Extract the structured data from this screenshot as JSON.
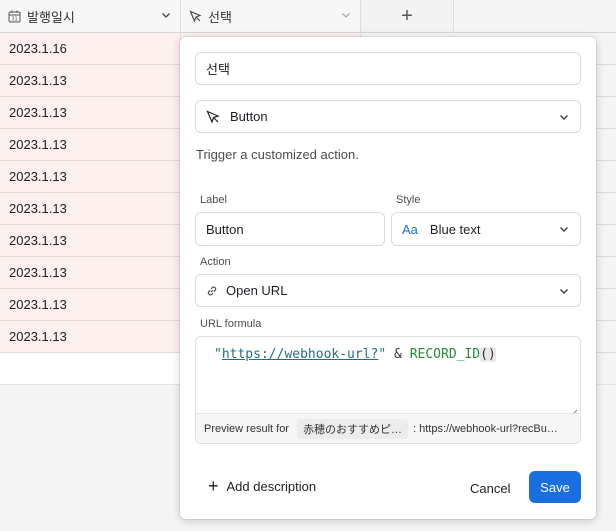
{
  "header": {
    "col1_label": "발행일시",
    "col2_label": "선택",
    "add_column_symbol": "+"
  },
  "rows": [
    "2023.1.16",
    "2023.1.13",
    "2023.1.13",
    "2023.1.13",
    "2023.1.13",
    "2023.1.13",
    "2023.1.13",
    "2023.1.13",
    "2023.1.13",
    "2023.1.13"
  ],
  "popup": {
    "field_name": "선택",
    "field_type": "Button",
    "type_description": "Trigger a customized action.",
    "label_caption": "Label",
    "label_value": "Button",
    "style_caption": "Style",
    "style_icon_text": "Aa",
    "style_value": "Blue text",
    "action_caption": "Action",
    "action_value": "Open URL",
    "url_formula_caption": "URL formula",
    "formula": {
      "quote_open": "\"",
      "url": "https://webhook-url?",
      "quote_close": "\"",
      "op": " & ",
      "fn": "RECORD_ID",
      "paren_open": "(",
      "paren_close": ")"
    },
    "preview_label": "Preview result for",
    "preview_record": "赤穂のおすすめピ…",
    "preview_result": ": https://webhook-url?recBu…",
    "add_description": "Add description",
    "cancel": "Cancel",
    "save": "Save"
  },
  "colors": {
    "accent": "#1a6fe0",
    "row_tint": "#fdf0ee",
    "formula_function": "#2b8a3e",
    "formula_string": "#1f6f8b"
  }
}
